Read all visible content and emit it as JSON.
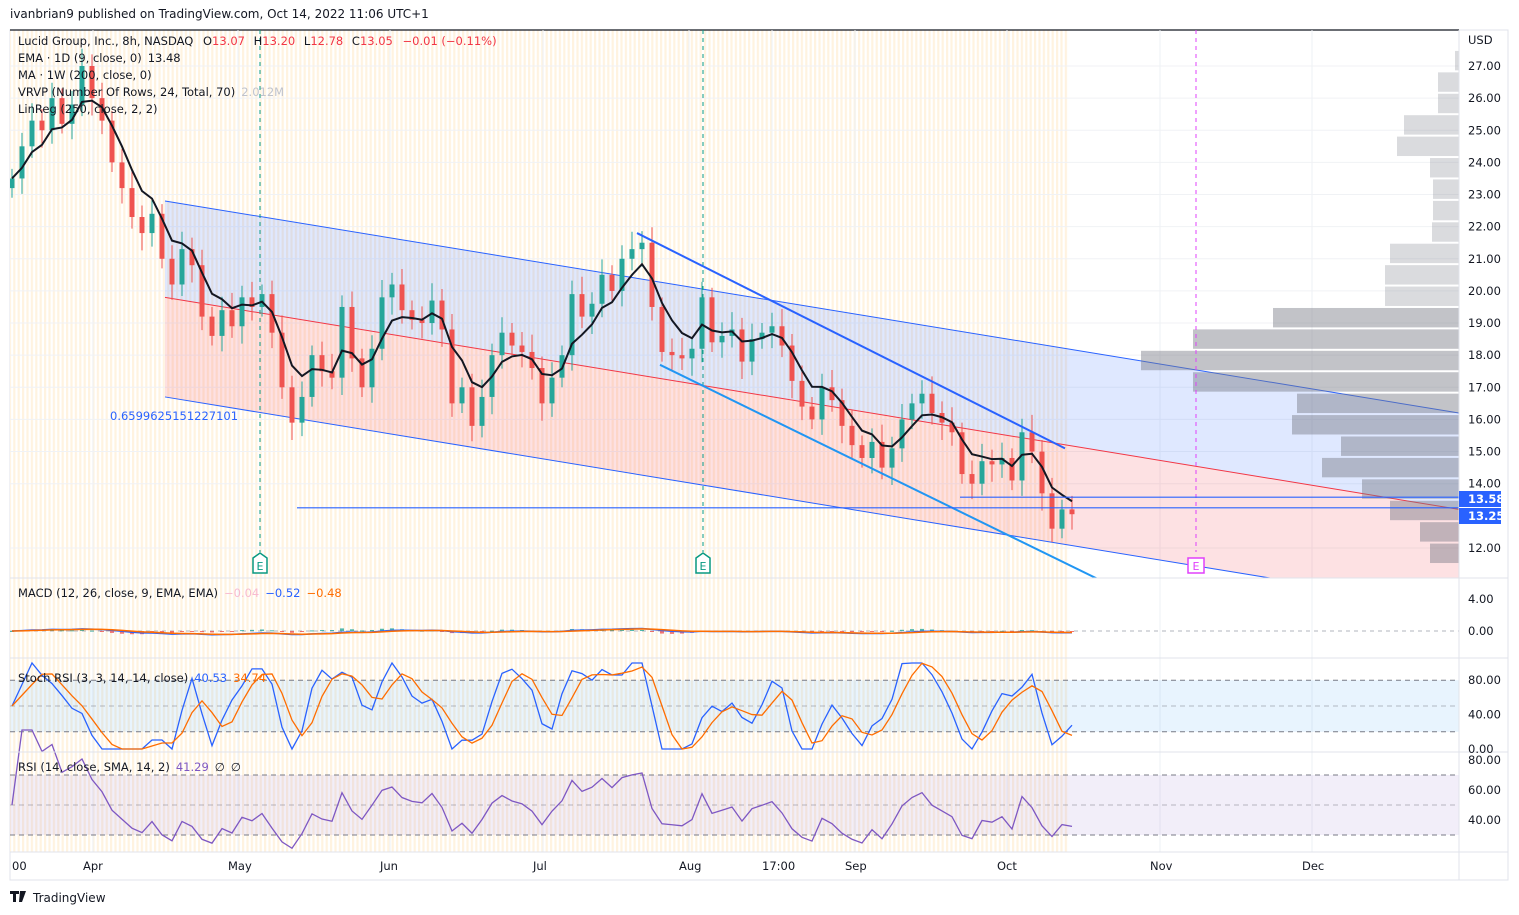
{
  "header": {
    "published": "ivanbrian9 published on TradingView.com, Oct 14, 2022 11:06 UTC+1"
  },
  "legend": {
    "symbol": "Lucid Group, Inc., 8h, NASDAQ",
    "o_label": "O",
    "o": "13.07",
    "h_label": "H",
    "h": "13.20",
    "l_label": "L",
    "l": "12.78",
    "c_label": "C",
    "c": "13.05",
    "change": "−0.01 (−0.11%)",
    "ema": "EMA · 1D (9, close, 0)",
    "ema_value": "13.48",
    "ma": "MA · 1W (200, close, 0)",
    "vrvp": "VRVP (Number Of Rows, 24, Total, 70)",
    "vrvp_value": "2.012M",
    "linreg": "LinReg (250, close, 2, 2)"
  },
  "price_axis": {
    "currency": "USD",
    "ticks": [
      "27.00",
      "26.00",
      "25.00",
      "24.00",
      "23.00",
      "22.00",
      "21.00",
      "20.00",
      "19.00",
      "18.00",
      "17.00",
      "16.00",
      "15.00",
      "14.00",
      "12.00"
    ],
    "tick_values": [
      27,
      26,
      25,
      24,
      23,
      22,
      21,
      20,
      19,
      18,
      17,
      16,
      15,
      14,
      12
    ]
  },
  "annotations": {
    "linreg_pearson": "0.6599625151227101",
    "support_1": {
      "label": "13.58",
      "value": 13.58
    },
    "support_2": {
      "label": "13.25",
      "value": 13.25
    },
    "earnings_marker": "E"
  },
  "colors": {
    "up": "#26a69a",
    "down": "#ef5350",
    "ema": "#131722",
    "trend": "#2962ff",
    "trend2": "#2196f3",
    "macd": "#2962ff",
    "signal": "#ff6d00",
    "rsi": "#7e57c2",
    "earnings_future": "#e040fb"
  },
  "chart_data": {
    "type": "candlestick",
    "title": "Lucid Group, Inc., 8h, NASDAQ",
    "ylim": [
      11,
      28
    ],
    "closes": [
      23.5,
      24.5,
      25.3,
      25.0,
      26.0,
      25.2,
      25.8,
      27.0,
      26.0,
      25.3,
      24.0,
      23.2,
      22.3,
      21.8,
      22.4,
      21.0,
      20.2,
      21.3,
      20.8,
      19.2,
      18.6,
      19.4,
      18.9,
      19.8,
      19.5,
      19.9,
      18.7,
      17.0,
      15.9,
      16.7,
      18.0,
      17.5,
      17.3,
      19.5,
      17.9,
      17.0,
      18.2,
      19.8,
      20.2,
      19.4,
      19.1,
      19.0,
      19.7,
      18.8,
      16.5,
      17.0,
      15.8,
      16.7,
      18.0,
      18.7,
      18.3,
      18.1,
      17.6,
      16.5,
      17.3,
      18.0,
      19.9,
      19.2,
      19.6,
      20.5,
      20.0,
      21.0,
      21.3,
      21.5,
      19.5,
      18.1,
      18.0,
      17.9,
      18.2,
      19.8,
      18.4,
      18.6,
      18.8,
      17.8,
      18.5,
      18.7,
      18.9,
      18.3,
      17.2,
      16.4,
      16.0,
      17.0,
      16.6,
      15.8,
      15.2,
      14.8,
      15.3,
      14.5,
      15.1,
      16.0,
      16.5,
      16.8,
      16.2,
      15.9,
      15.6,
      14.3,
      14.0,
      14.7,
      14.6,
      14.8,
      14.1,
      15.6,
      15.0,
      13.7,
      12.6,
      13.2,
      13.05
    ],
    "linreg": {
      "upper": [
        22.8,
        16.2
      ],
      "middle": [
        19.8,
        13.2
      ],
      "lower": [
        16.7,
        10.1
      ]
    },
    "trendlines": [
      {
        "from": 21.8,
        "to": 15.1
      },
      {
        "from": 17.7,
        "to": 11.0
      }
    ],
    "volume_profile": {
      "price_min": 11.5,
      "price_max": 27.5,
      "volumes_top_to_bottom": [
        4,
        21,
        21,
        55,
        62,
        29,
        26,
        26,
        27,
        69,
        74,
        74,
        186,
        266,
        318,
        266,
        162,
        167,
        118,
        137,
        97,
        69,
        39,
        29
      ],
      "value_area_from_row": 12
    },
    "x_labels": [
      "00",
      "Apr",
      "May",
      "Jun",
      "Jul",
      "Aug",
      "17:00",
      "Sep",
      "Oct",
      "Nov",
      "Dec"
    ]
  },
  "indicators": {
    "macd": {
      "label": "MACD (12, 26, close, 9, EMA, EMA)",
      "hist": "−0.04",
      "macd": "−0.52",
      "signal": "−0.48",
      "ticks": [
        "4.00",
        "0.00"
      ]
    },
    "stoch": {
      "label": "Stoch RSI (3, 3, 14, 14, close)",
      "k": "40.53",
      "d": "34.74",
      "ticks": [
        "80.00",
        "40.00",
        "0.00"
      ]
    },
    "rsi": {
      "label": "RSI (14, close, SMA, 14, 2)",
      "value": "41.29",
      "na1": "∅",
      "na2": "∅",
      "ticks": [
        "80.00",
        "60.00",
        "40.00"
      ]
    }
  },
  "footer": {
    "brand": "TradingView"
  }
}
